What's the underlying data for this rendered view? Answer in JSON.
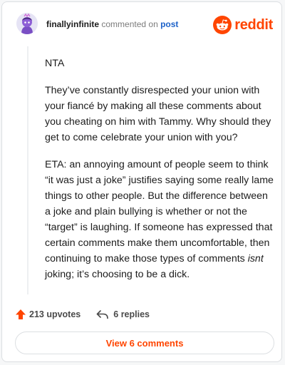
{
  "header": {
    "username": "finallyinfinite",
    "action_text": "commented on",
    "post_link": "post",
    "brand": "reddit",
    "brand_color": "#ff4500"
  },
  "comment": {
    "paragraphs": [
      "NTA",
      "They’ve constantly disrespected your union with your fiancé by making all these comments about you cheating on him with Tammy. Why should they get to come celebrate your union with you?"
    ],
    "eta": {
      "before": "ETA: an annoying amount of people seem to think “it was just a joke” justifies saying some really lame things to other people. But the difference between a joke and plain bullying is whether or not the “target” is laughing. If someone has expressed that certain comments make them uncomfortable, then continuing to make those types of comments ",
      "emphasis": "isnt",
      "after": " joking; it’s choosing to be a dick."
    }
  },
  "footer": {
    "upvotes": "213 upvotes",
    "replies": "6 replies",
    "upvote_icon": "upvote-arrow-icon",
    "reply_icon": "reply-arrow-icon"
  },
  "actions": {
    "view_comments": "View 6 comments"
  }
}
